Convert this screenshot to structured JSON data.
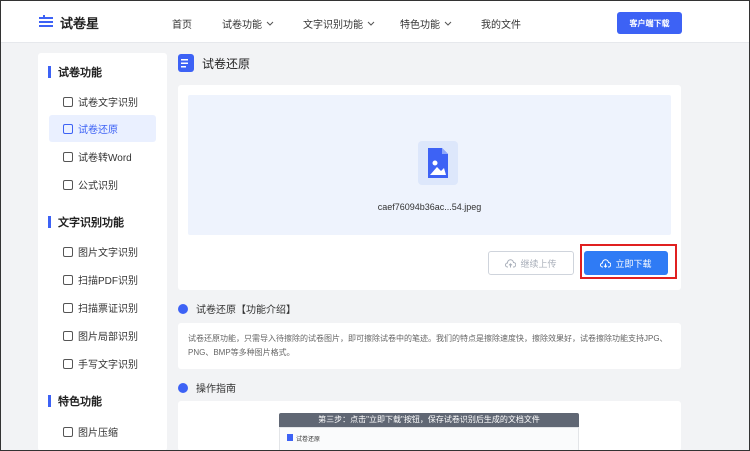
{
  "logo": {
    "text": "试卷星"
  },
  "nav": {
    "items": [
      {
        "label": "首页",
        "has_dropdown": false
      },
      {
        "label": "试卷功能",
        "has_dropdown": true
      },
      {
        "label": "文字识别功能",
        "has_dropdown": true
      },
      {
        "label": "特色功能",
        "has_dropdown": true
      },
      {
        "label": "我的文件",
        "has_dropdown": false
      }
    ],
    "download_client_label": "客户端下载"
  },
  "sidebar": {
    "sections": [
      {
        "title": "试卷功能",
        "items": [
          {
            "label": "试卷文字识别",
            "active": false
          },
          {
            "label": "试卷还原",
            "active": true
          },
          {
            "label": "试卷转Word",
            "active": false
          },
          {
            "label": "公式识别",
            "active": false
          }
        ]
      },
      {
        "title": "文字识别功能",
        "items": [
          {
            "label": "图片文字识别",
            "active": false
          },
          {
            "label": "扫描PDF识别",
            "active": false
          },
          {
            "label": "扫描票证识别",
            "active": false
          },
          {
            "label": "图片局部识别",
            "active": false
          },
          {
            "label": "手写文字识别",
            "active": false
          }
        ]
      },
      {
        "title": "特色功能",
        "items": [
          {
            "label": "图片压缩",
            "active": false
          }
        ]
      }
    ]
  },
  "main": {
    "page_title": "试卷还原",
    "upload": {
      "file_name": "caef76094b36ac...54.jpeg",
      "continue_label": "继续上传",
      "download_label": "立即下载"
    },
    "intro": {
      "heading": "试卷还原【功能介绍】",
      "text": "试卷还原功能，只需导入待擦除的试卷图片，即可擦除试卷中的笔迹。我们的特点是擦除速度快，擦除效果好，试卷擦除功能支持JPG、PNG、BMP等多种图片格式。"
    },
    "guide": {
      "heading": "操作指南",
      "banner": "第三步：点击\"立即下载\"按钮，保存试卷识别后生成的文档文件",
      "shot_title": "试卷还原"
    }
  },
  "colors": {
    "accent": "#3d62f5",
    "download_button": "#2f7bf5",
    "highlight": "#e02020"
  }
}
